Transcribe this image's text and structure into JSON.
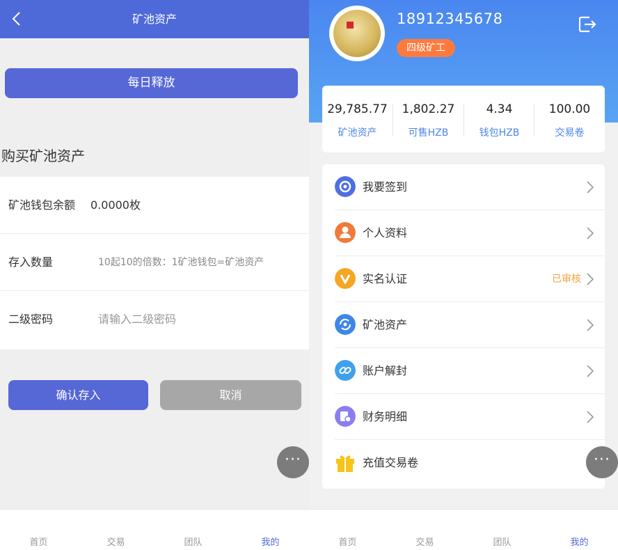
{
  "left": {
    "header_title": "矿池资产",
    "daily_release_label": "每日释放",
    "section_title": "购买矿池资产",
    "rows": [
      {
        "label": "矿池钱包余额",
        "value": "0.0000枚"
      },
      {
        "label": "存入数量",
        "placeholder": "10起10的倍数：1矿池钱包=矿池资产"
      },
      {
        "label": "二级密码",
        "placeholder": "请输入二级密码"
      }
    ],
    "confirm_label": "确认存入",
    "cancel_label": "取消",
    "more_label": "···"
  },
  "right": {
    "phone": "18912345678",
    "level": "四级矿工",
    "stats": [
      {
        "value": "29,785.77",
        "label": "矿池资产"
      },
      {
        "value": "1,802.27",
        "label": "可售HZB"
      },
      {
        "value": "4.34",
        "label": "钱包HZB"
      },
      {
        "value": "100.00",
        "label": "交易卷"
      }
    ],
    "menu": [
      {
        "label": "我要签到",
        "icon": "checkin-icon",
        "color": "#4f6fe0",
        "status": ""
      },
      {
        "label": "个人资料",
        "icon": "profile-icon",
        "color": "#f07a3a",
        "status": ""
      },
      {
        "label": "实名认证",
        "icon": "verify-icon",
        "color": "#f5a623",
        "status": "已审核"
      },
      {
        "label": "矿池资产",
        "icon": "pool-asset-icon",
        "color": "#3f86e8",
        "status": ""
      },
      {
        "label": "账户解封",
        "icon": "unlock-link-icon",
        "color": "#3fa0ee",
        "status": ""
      },
      {
        "label": "财务明细",
        "icon": "finance-icon",
        "color": "#8a7ef0",
        "status": ""
      },
      {
        "label": "充值交易卷",
        "icon": "gift-icon",
        "color": "#f5c518",
        "status": ""
      }
    ],
    "more_label": "···"
  },
  "tabs": [
    "首页",
    "交易",
    "团队",
    "我的"
  ],
  "active_tab": "我的",
  "colors": {
    "primary": "#5667d6",
    "header_blue": "#4e6ad8",
    "accent_orange": "#ff7a3f",
    "status_orange": "#f4a23d",
    "stat_label_blue": "#4e86e8"
  }
}
